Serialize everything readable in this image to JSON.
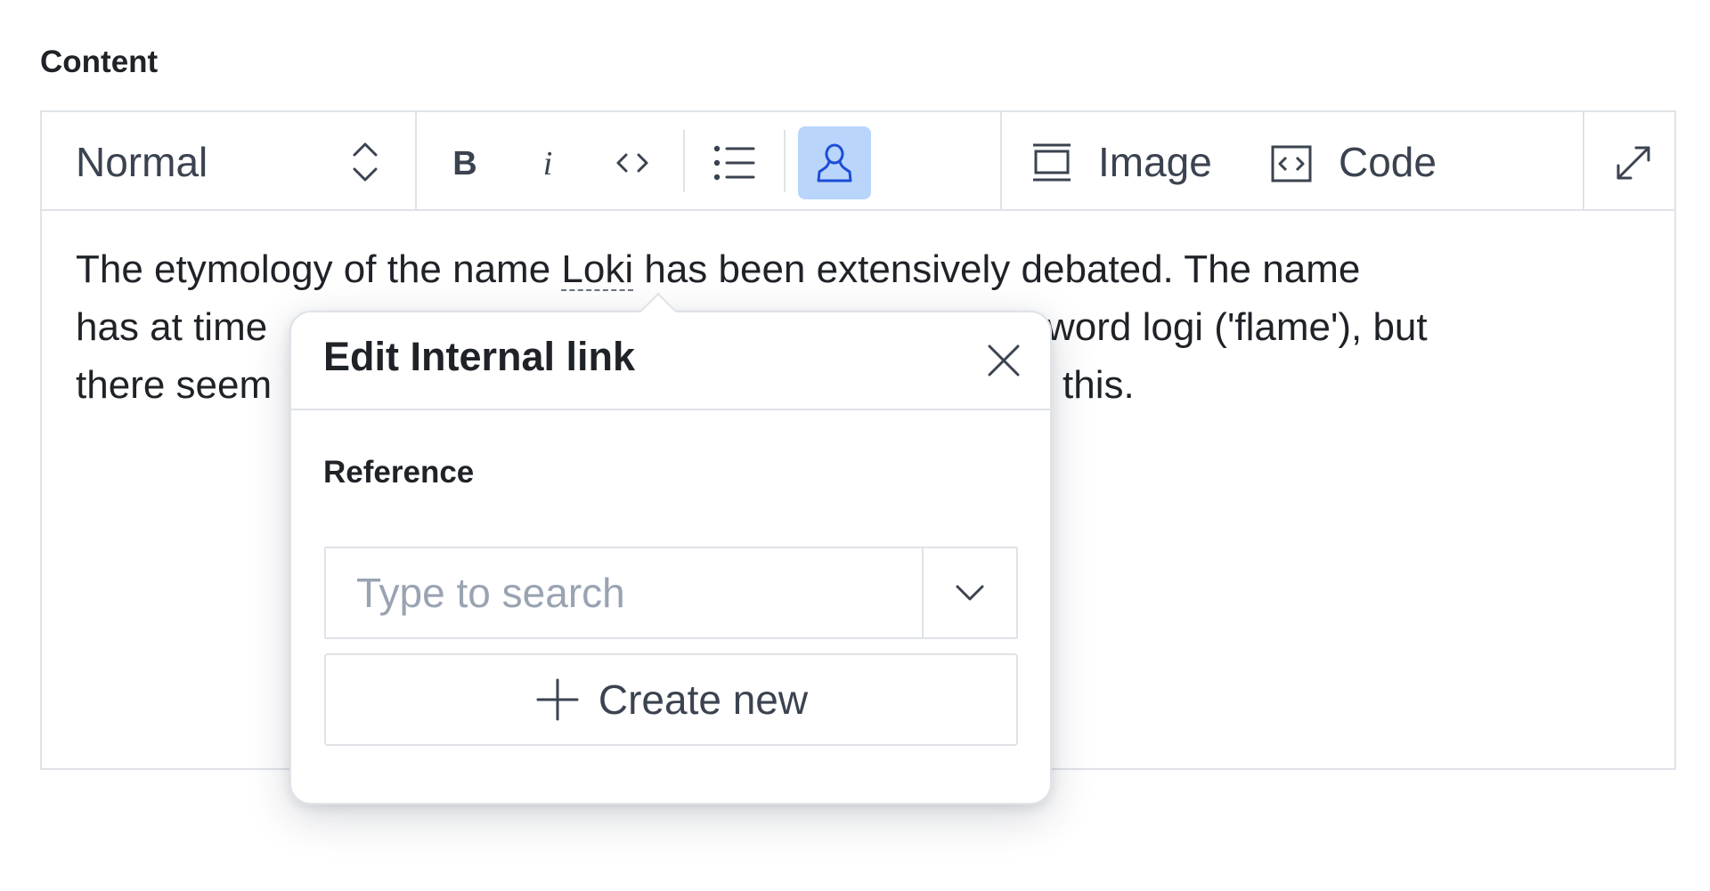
{
  "field": {
    "label": "Content"
  },
  "toolbar": {
    "style_select": "Normal",
    "image_label": "Image",
    "code_label": "Code"
  },
  "editor": {
    "text_before": "The etymology of the name ",
    "link_text": "Loki",
    "line1_after": " has been extensively debated. The name",
    "line2_visible_start": "has at time",
    "line2_visible_end": "word logi ('flame'), but",
    "line3_visible_start": "there seem",
    "line3_visible_end": "this."
  },
  "popover": {
    "title": "Edit Internal link",
    "reference_label": "Reference",
    "search_placeholder": "Type to search",
    "create_label": "Create new"
  },
  "colors": {
    "active_button_bg": "#b9d5fb",
    "active_icon": "#1d4ed8",
    "border": "#dfe3e8"
  },
  "icons": [
    "chevron-up-down-icon",
    "bold-icon",
    "italic-icon",
    "inline-code-icon",
    "bullet-list-icon",
    "internal-link-icon",
    "image-icon",
    "code-block-icon",
    "expand-icon",
    "close-icon",
    "chevron-down-icon",
    "plus-icon"
  ]
}
